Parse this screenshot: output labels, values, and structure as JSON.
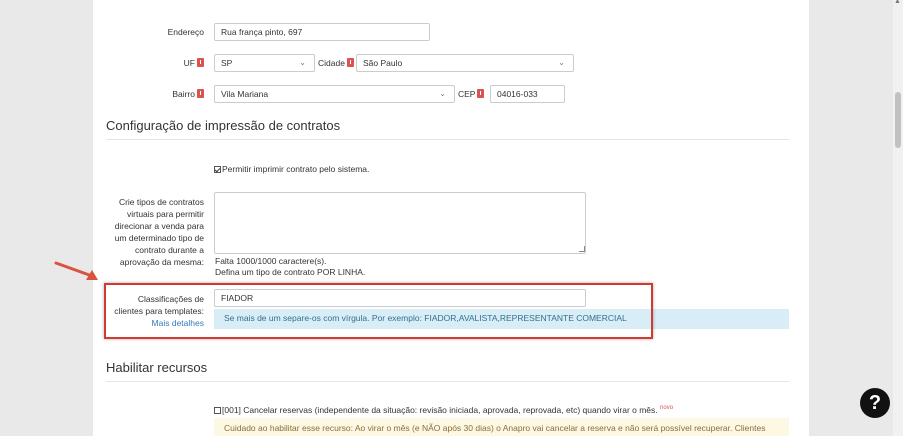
{
  "address": {
    "label": "Endereço",
    "value": "Rua frança pinto, 697"
  },
  "uf": {
    "label": "UF",
    "value": "SP"
  },
  "city": {
    "label": "Cidade",
    "value": "São Paulo"
  },
  "district": {
    "label": "Bairro",
    "value": "Vila Mariana"
  },
  "cep": {
    "label": "CEP",
    "value": "04016-033"
  },
  "contracts_section": {
    "title": "Configuração de impressão de contratos",
    "allow_print_label": "Permitir imprimir contrato pelo sistema.",
    "allow_print_checked": true,
    "virtual_types_label": "Crie tipos de contratos virtuais para permitir direcionar a venda para um determinado tipo de contrato durante a aprovação da mesma:",
    "virtual_types_value": "",
    "char_count": "Falta 1000/1000 caractere(s).",
    "line_hint": "Defina um tipo de contrato POR LINHA.",
    "classif_label": "Classificações de clientes para templates:",
    "classif_more": "Mais detalhes",
    "classif_value": "FIADOR",
    "classif_info": "Se mais de um separe-os com vírgula. Por exemplo: FIADOR,AVALISTA,REPRESENTANTE COMERCIAL"
  },
  "resources_section": {
    "title": "Habilitar recursos",
    "item_001_label": "[001] Cancelar reservas (independente da situação: revisão iniciada, aprovada, reprovada, etc) quando virar o mês.",
    "item_001_badge": "novo",
    "item_001_checked": false,
    "item_001_warning": "Cuidado ao habilitar esse recurso: Ao virar o mês (e NÃO após 30 dias) o Anapro vai cancelar a reserva e não será possível recuperar. Clientes"
  },
  "help_button": {
    "label": "?"
  },
  "colors": {
    "accent_red": "#d13b2f",
    "info_bg": "#d9edf7",
    "warn_bg": "#fcf8e3",
    "link": "#337ab7"
  }
}
